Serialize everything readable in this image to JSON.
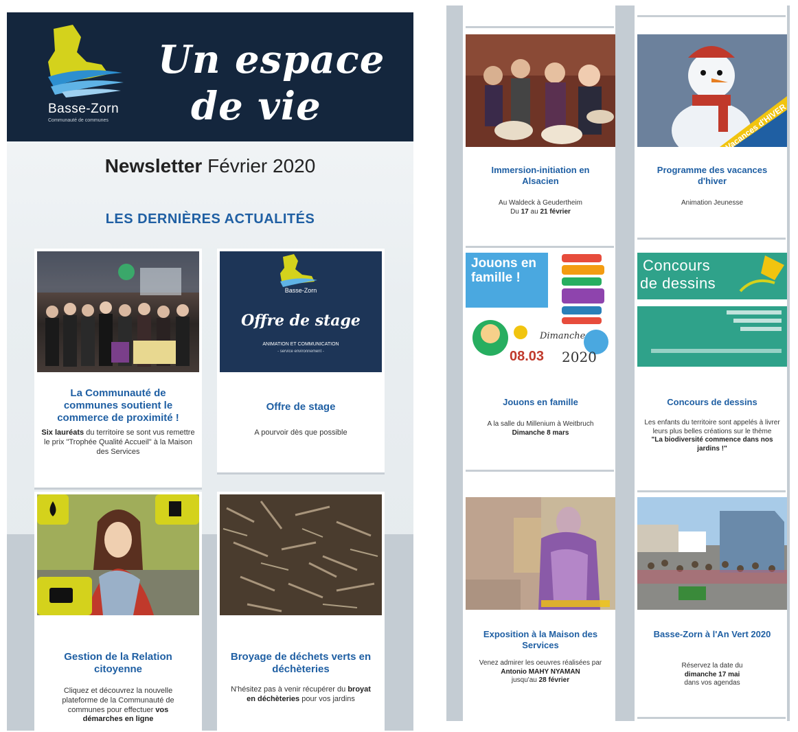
{
  "header": {
    "brand": "Basse-Zorn",
    "brand_sub": "Communauté de communes",
    "tagline_line1": "Un espace",
    "tagline_line2": "de vie"
  },
  "newsletter": {
    "title_bold": "Newsletter",
    "title_rest": " Février 2020"
  },
  "section_heading": "LES DERNIÈRES ACTUALITÉS",
  "left_cards": [
    {
      "title": "La Communauté de communes soutient le commerce de proximité !",
      "text_bold": "Six lauréats",
      "text": " du territoire se sont vus remettre le prix \"Trophée Qualité Accueil\" à la Maison des Services",
      "image": "award-ceremony-photo"
    },
    {
      "title": "Offre de stage",
      "text": "A pourvoir dès que possible",
      "image": "offre-de-stage-poster",
      "poster_title": "Offre de stage",
      "poster_line1": "ANIMATION ET COMMUNICATION",
      "poster_line2": "- service environnement -",
      "poster_brand": "Basse-Zorn"
    },
    {
      "title": "Gestion de la Relation citoyenne",
      "text": "Cliquez et découvrez la nouvelle plateforme de la Communauté de communes pour effectuer ",
      "text_bold": "vos démarches en ligne",
      "image": "woman-with-tablet-photo"
    },
    {
      "title": "Broyage de déchets verts en déchèteries",
      "text_pre": "N'hésitez pas à venir récupérer du ",
      "text_bold": "broyat en déchèteries",
      "text_post": " pour vos jardins",
      "image": "wood-chips-photo"
    }
  ],
  "right_cards": [
    {
      "title": "Immersion-initiation en Alsacien",
      "line1": "Au Waldeck à Geudertheim",
      "line2_pre": "Du ",
      "line2_b1": "17",
      "line2_mid": " au  ",
      "line2_b2": "21 février",
      "image": "drum-class-photo"
    },
    {
      "title": "Programme des vacances d'hiver",
      "line1": "Animation Jeunesse",
      "image": "snowman-photo",
      "badge_text": "Vacances d'HIVER"
    },
    {
      "title": "Jouons en famille",
      "line1": "A la salle du Millenium à Weitbruch",
      "line2_bold": "Dimanche 8 mars",
      "image": "jouons-en-famille-poster",
      "poster_title": "Jouons en famille !",
      "poster_day": "Dimanche",
      "poster_date": "08.03",
      "poster_year": "2020"
    },
    {
      "title": "Concours de dessins",
      "line1": "Les enfants du territoire sont appelés à livrer leurs plus belles créations sur le thème",
      "line2_bold": "\"La biodiversité commence dans nos jardins !\"",
      "image": "concours-de-dessins-poster",
      "poster_title1": "Concours",
      "poster_title2": "de dessins"
    },
    {
      "title": "Exposition à la Maison des Services",
      "line1": "Venez admirer les oeuvres réalisées par",
      "line2_bold": "Antonio MAHY NYAMAN",
      "line3_pre": "jusqu'au ",
      "line3_bold": "28 février",
      "image": "painting-photo"
    },
    {
      "title": "Basse-Zorn à l'An Vert 2020",
      "line1": "Réservez la date du",
      "line2_bold": "dimanche 17 mai",
      "line3": "dans vos agendas",
      "image": "market-event-photo"
    }
  ],
  "colors": {
    "accent_blue": "#1f5fa3",
    "header_navy": "#14263d",
    "logo_yellow": "#d4d21c",
    "panel_grey": "#c4ccd3"
  }
}
